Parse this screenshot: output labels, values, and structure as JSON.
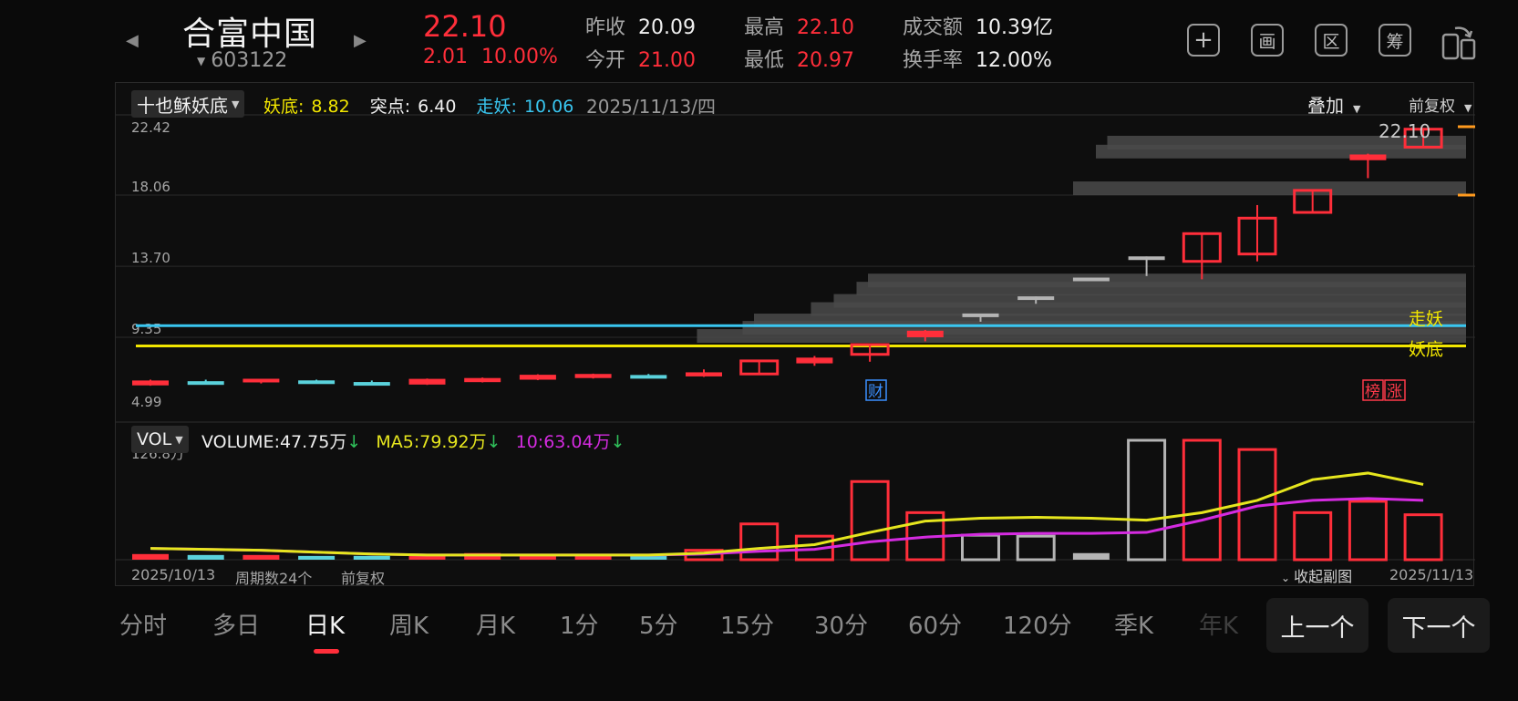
{
  "header": {
    "prev_arrow": "◀",
    "next_arrow": "▶",
    "stock_name": "合富中国",
    "stock_code": "603122",
    "price": "22.10",
    "change": "2.01",
    "change_pct": "10.00%",
    "quotes": {
      "prev_close": {
        "label": "昨收",
        "value": "20.09"
      },
      "open": {
        "label": "今开",
        "value": "21.00"
      },
      "high": {
        "label": "最高",
        "value": "22.10"
      },
      "low": {
        "label": "最低",
        "value": "20.97"
      },
      "turnover": {
        "label": "成交额",
        "value": "10.39亿"
      },
      "turnover_rate": {
        "label": "换手率",
        "value": "12.00%"
      }
    },
    "tools": {
      "add": "+",
      "draw": "画",
      "range": "区",
      "chips": "筹"
    }
  },
  "indicator": {
    "name": "十也稣妖底",
    "low_label": "妖底:",
    "low_value": "8.82",
    "break_label": "突点:",
    "break_value": "6.40",
    "walk_label": "走妖:",
    "walk_value": "10.06",
    "date": "2025/11/13/四",
    "overlay_label": "叠加",
    "adjust_label": "前复权",
    "price_label": "22.10",
    "line_label_walk": "走妖",
    "line_label_low": "妖底",
    "marker_cai": "财",
    "marker_bang": "榜",
    "marker_zhang": "涨"
  },
  "volume": {
    "name": "VOL",
    "volume_label": "VOLUME:",
    "volume_value": "47.75万",
    "ma5_label": "MA5:",
    "ma5_value": "79.92万",
    "ma10_label": "10:",
    "ma10_value": "63.04万",
    "arrow": "↓",
    "axis_max": "126.8万"
  },
  "footer": {
    "start_date": "2025/10/13",
    "period_count": "周期数24个",
    "adjust": "前复权",
    "collapse": "收起副图",
    "end_date": "2025/11/13"
  },
  "periods": [
    "分时",
    "多日",
    "日K",
    "周K",
    "月K",
    "1分",
    "5分",
    "15分",
    "30分",
    "60分",
    "120分",
    "季K",
    "年K"
  ],
  "pager": {
    "prev": "上一个",
    "next": "下一个"
  },
  "colors": {
    "up": "#ff2e3a",
    "flat": "#5ad2dc",
    "neutral": "#b4b4b4",
    "walk_line": "#39c6f0",
    "low_line": "#f2e600",
    "ma5": "#e6e61e",
    "ma10": "#d42be0"
  },
  "chart_data": {
    "type": "candlestick",
    "y_ticks": [
      "22.42",
      "18.06",
      "13.70",
      "9.35",
      "4.99"
    ],
    "ylim": [
      4.99,
      22.42
    ],
    "lines": {
      "walk": 10.06,
      "low": 8.82
    },
    "candles": [
      {
        "o": 6.4,
        "c": 6.7,
        "h": 6.75,
        "l": 6.38,
        "t": "up"
      },
      {
        "o": 6.6,
        "c": 6.55,
        "h": 6.75,
        "l": 6.5,
        "t": "flat"
      },
      {
        "o": 6.55,
        "c": 6.75,
        "h": 6.78,
        "l": 6.52,
        "t": "up"
      },
      {
        "o": 6.65,
        "c": 6.6,
        "h": 6.75,
        "l": 6.55,
        "t": "flat"
      },
      {
        "o": 6.45,
        "c": 6.55,
        "h": 6.7,
        "l": 6.4,
        "t": "flat"
      },
      {
        "o": 6.45,
        "c": 6.8,
        "h": 6.82,
        "l": 6.43,
        "t": "up"
      },
      {
        "o": 6.6,
        "c": 6.85,
        "h": 6.88,
        "l": 6.58,
        "t": "up"
      },
      {
        "o": 6.75,
        "c": 7.05,
        "h": 7.08,
        "l": 6.72,
        "t": "up"
      },
      {
        "o": 6.85,
        "c": 7.1,
        "h": 7.12,
        "l": 6.82,
        "t": "up"
      },
      {
        "o": 6.98,
        "c": 6.93,
        "h": 7.1,
        "l": 6.9,
        "t": "flat"
      },
      {
        "o": 6.95,
        "c": 7.2,
        "h": 7.38,
        "l": 6.92,
        "t": "up"
      },
      {
        "o": 7.1,
        "c": 7.9,
        "h": 7.92,
        "l": 7.08,
        "t": "up"
      },
      {
        "o": 7.75,
        "c": 8.1,
        "h": 8.2,
        "l": 7.6,
        "t": "up"
      },
      {
        "o": 8.3,
        "c": 8.9,
        "h": 8.95,
        "l": 7.85,
        "t": "up"
      },
      {
        "o": 9.35,
        "c": 9.75,
        "h": 9.8,
        "l": 9.1,
        "t": "up"
      },
      {
        "o": 10.75,
        "c": 10.75,
        "h": 10.8,
        "l": 10.3,
        "t": "neutral"
      },
      {
        "o": 11.8,
        "c": 11.8,
        "h": 11.85,
        "l": 11.4,
        "t": "neutral"
      },
      {
        "o": 12.95,
        "c": 12.95,
        "h": 13.0,
        "l": 12.95,
        "t": "neutral"
      },
      {
        "o": 14.25,
        "c": 14.25,
        "h": 14.3,
        "l": 13.1,
        "t": "neutral"
      },
      {
        "o": 14.0,
        "c": 15.7,
        "h": 15.72,
        "l": 12.9,
        "t": "up"
      },
      {
        "o": 14.45,
        "c": 16.65,
        "h": 17.45,
        "l": 14.0,
        "t": "up"
      },
      {
        "o": 17.0,
        "c": 18.35,
        "h": 18.4,
        "l": 17.0,
        "t": "up"
      },
      {
        "o": 20.2,
        "c": 20.55,
        "h": 20.6,
        "l": 19.1,
        "t": "up"
      },
      {
        "o": 21.0,
        "c": 22.1,
        "h": 22.1,
        "l": 20.97,
        "t": "up"
      }
    ],
    "volume": {
      "max": 126.8,
      "bars": [
        6,
        5,
        5,
        4,
        4,
        5,
        7,
        6,
        6,
        5,
        10,
        38,
        25,
        83,
        50,
        26,
        25,
        7,
        126.8,
        126.8,
        117,
        50,
        62,
        47.75
      ],
      "ma5": [
        12,
        11,
        10,
        8,
        6,
        5,
        5,
        5,
        5,
        5,
        7,
        12,
        16,
        29,
        41,
        44,
        45,
        44,
        42,
        50,
        63,
        85,
        92,
        79.92
      ],
      "ma10": [
        12,
        11,
        10,
        8,
        6,
        5,
        5,
        5,
        5,
        5,
        6,
        9,
        11,
        19,
        24,
        27,
        28,
        28,
        29,
        42,
        57,
        63,
        65,
        63.04
      ]
    }
  }
}
